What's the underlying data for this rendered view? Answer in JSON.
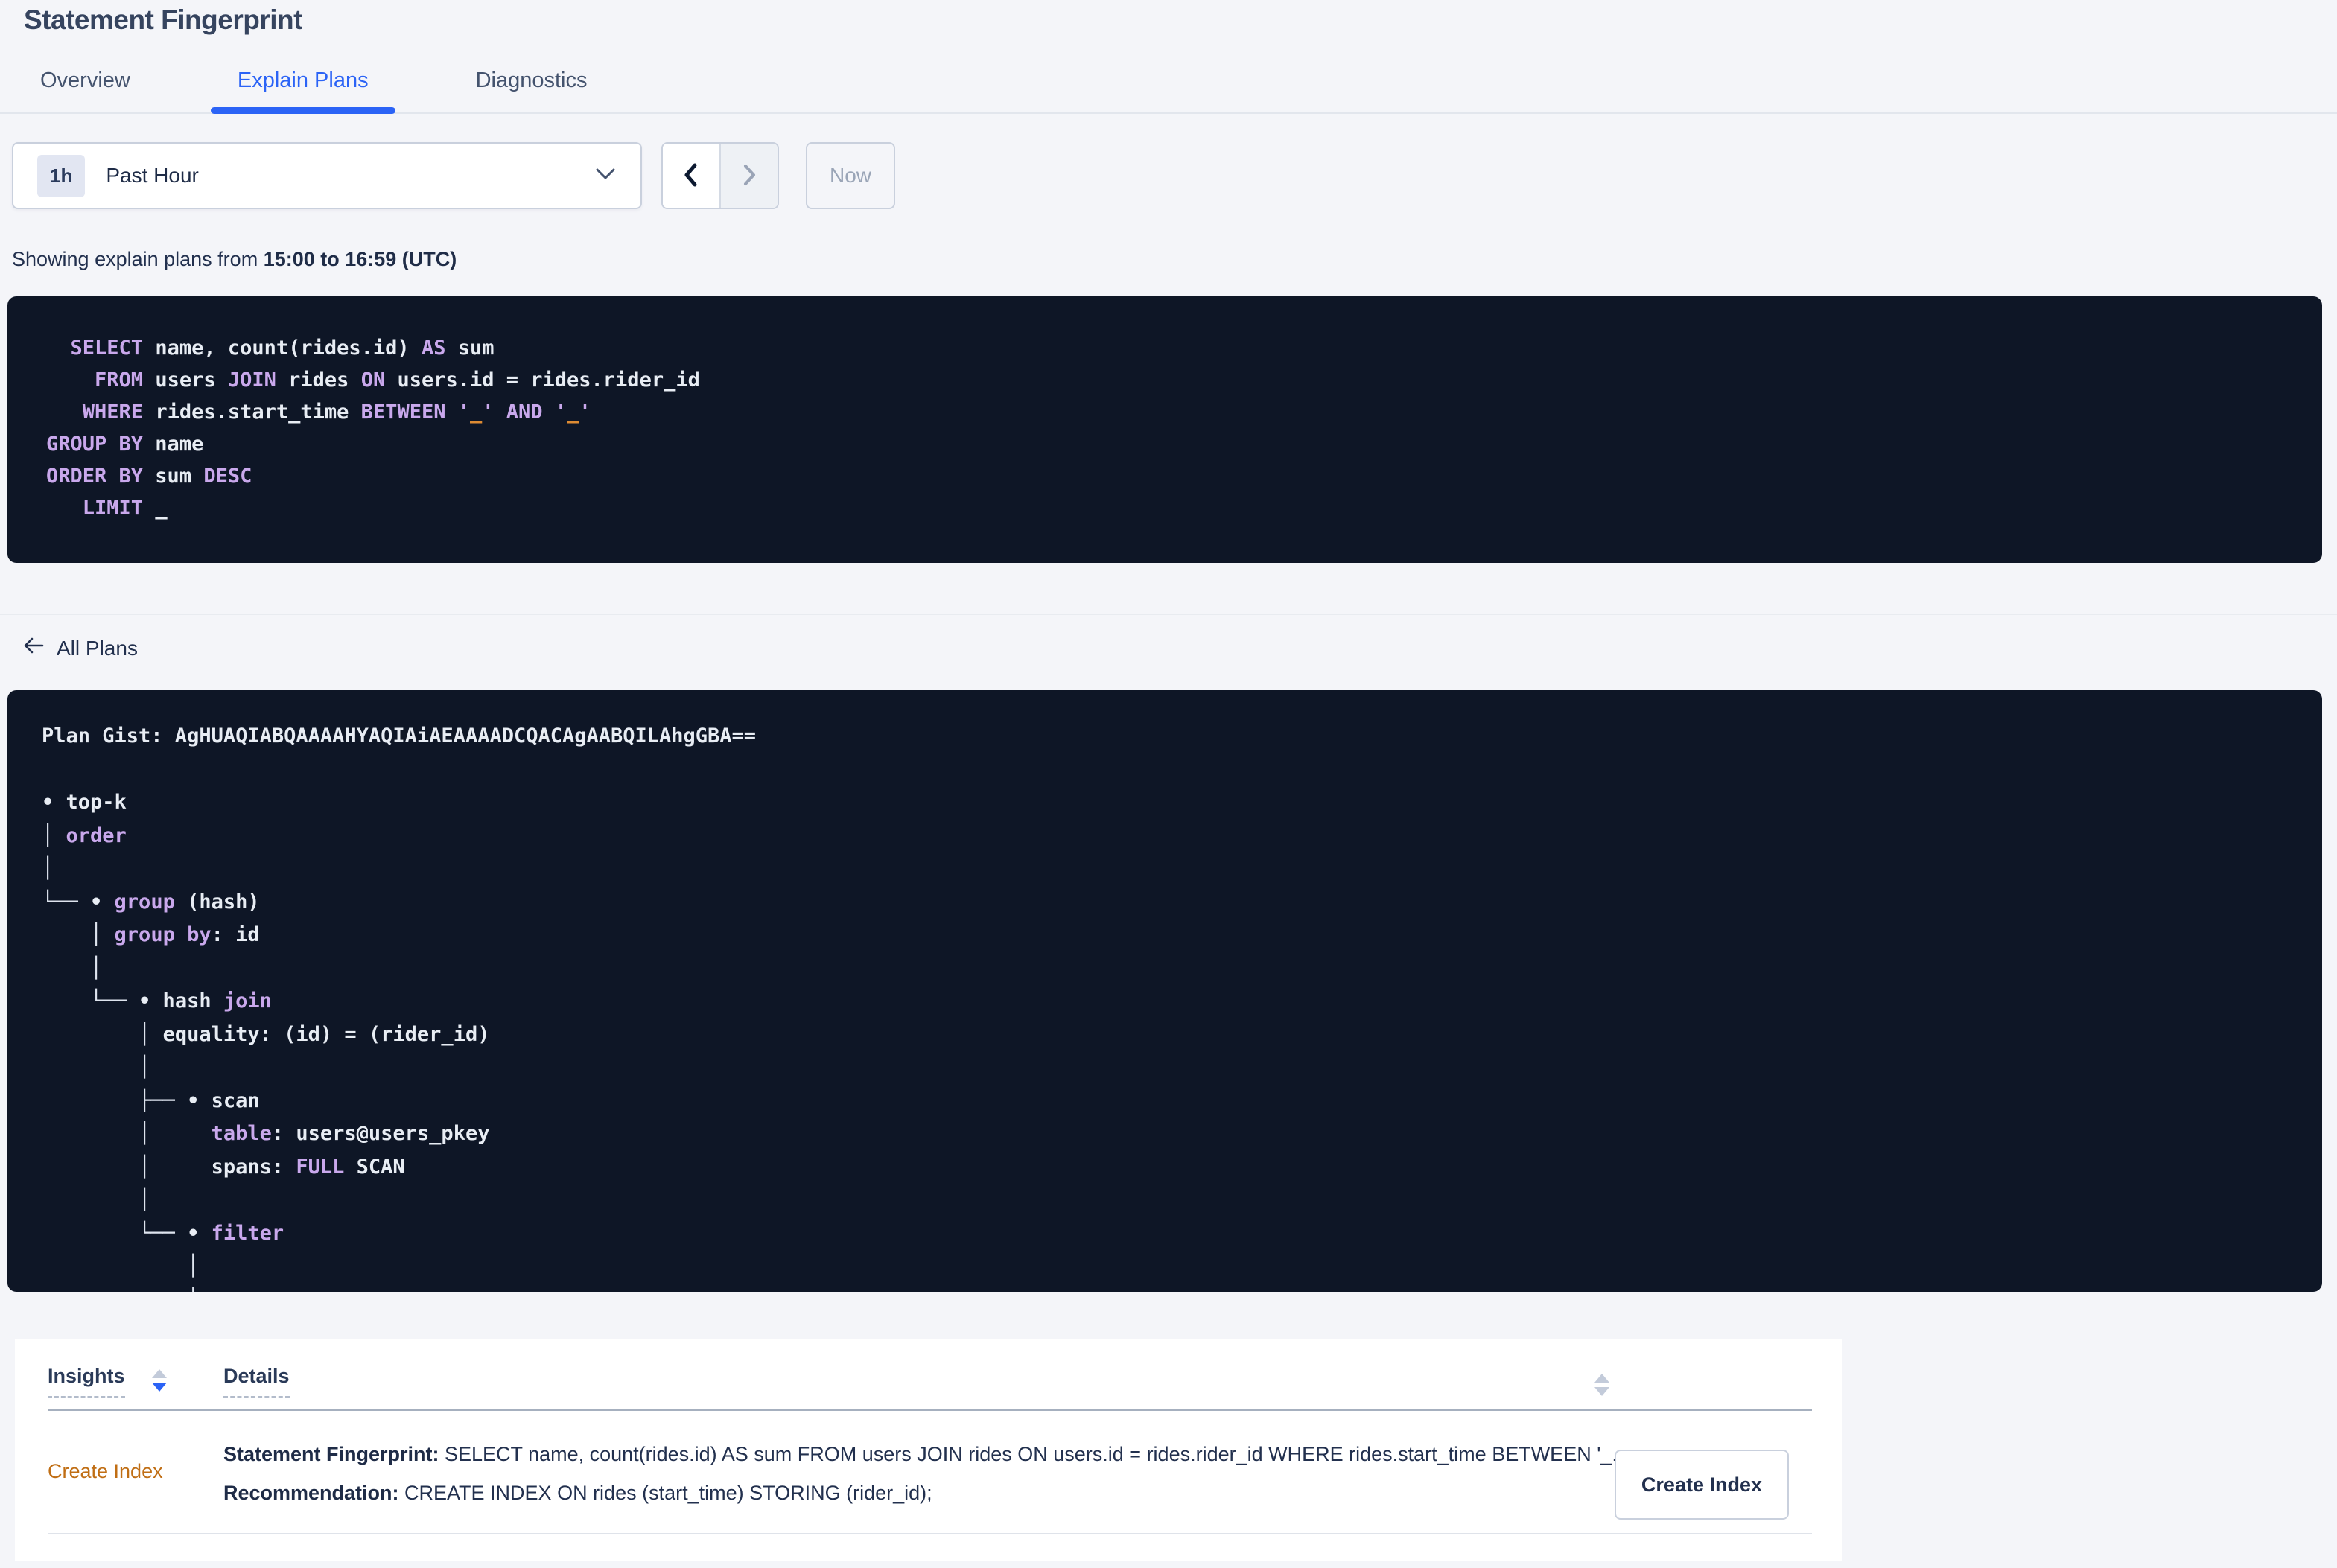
{
  "page": {
    "title": "Statement Fingerprint"
  },
  "tabs": [
    {
      "label": "Overview",
      "active": false
    },
    {
      "label": "Explain Plans",
      "active": true
    },
    {
      "label": "Diagnostics",
      "active": false
    }
  ],
  "time_controls": {
    "interval_badge": "1h",
    "selected_range": "Past Hour",
    "now_button": "Now"
  },
  "status_line": {
    "prefix": "Showing explain plans from ",
    "bold_range": "15:00 to 16:59 (UTC)"
  },
  "sql_statement": {
    "lines": [
      [
        [
          "t",
          "  "
        ],
        [
          "k",
          "SELECT"
        ],
        [
          "t",
          " name, count(rides.id) "
        ],
        [
          "k",
          "AS"
        ],
        [
          "t",
          " sum"
        ]
      ],
      [
        [
          "t",
          "    "
        ],
        [
          "k",
          "FROM"
        ],
        [
          "t",
          " users "
        ],
        [
          "k",
          "JOIN"
        ],
        [
          "t",
          " rides "
        ],
        [
          "k",
          "ON"
        ],
        [
          "t",
          " users.id = rides.rider_id"
        ]
      ],
      [
        [
          "t",
          "   "
        ],
        [
          "k",
          "WHERE"
        ],
        [
          "t",
          " rides.start_time "
        ],
        [
          "k",
          "BETWEEN"
        ],
        [
          "t",
          " "
        ],
        [
          "k",
          "'"
        ],
        [
          "o",
          "_"
        ],
        [
          "k",
          "'"
        ],
        [
          "t",
          " "
        ],
        [
          "k",
          "AND"
        ],
        [
          "t",
          " "
        ],
        [
          "k",
          "'"
        ],
        [
          "o",
          "_"
        ],
        [
          "k",
          "'"
        ]
      ],
      [
        [
          "k",
          "GROUP BY"
        ],
        [
          "t",
          " name"
        ]
      ],
      [
        [
          "k",
          "ORDER BY"
        ],
        [
          "t",
          " sum "
        ],
        [
          "k",
          "DESC"
        ]
      ],
      [
        [
          "t",
          "   "
        ],
        [
          "k",
          "LIMIT"
        ],
        [
          "t",
          " _"
        ]
      ]
    ]
  },
  "explain_plan": {
    "back_link": "All Plans",
    "lines": [
      [
        [
          "t",
          "Plan Gist: AgHUAQIABQAAAAHYAQIAiAEAAAADCQACAgAABQILAhgGBA=="
        ]
      ],
      [],
      [
        [
          "t",
          "• top-k"
        ]
      ],
      [
        [
          "g",
          "│ "
        ],
        [
          "k",
          "order"
        ]
      ],
      [
        [
          "g",
          "│"
        ]
      ],
      [
        [
          "g",
          "└── "
        ],
        [
          "t",
          "• "
        ],
        [
          "k",
          "group"
        ],
        [
          "t",
          " (hash)"
        ]
      ],
      [
        [
          "g",
          "    │ "
        ],
        [
          "k",
          "group by"
        ],
        [
          "t",
          ": id"
        ]
      ],
      [
        [
          "g",
          "    │"
        ]
      ],
      [
        [
          "g",
          "    └── "
        ],
        [
          "t",
          "• hash "
        ],
        [
          "k",
          "join"
        ]
      ],
      [
        [
          "g",
          "        │ "
        ],
        [
          "t",
          "equality: (id) = (rider_id)"
        ]
      ],
      [
        [
          "g",
          "        │"
        ]
      ],
      [
        [
          "g",
          "        ├── "
        ],
        [
          "t",
          "• scan"
        ]
      ],
      [
        [
          "g",
          "        │     "
        ],
        [
          "k",
          "table"
        ],
        [
          "t",
          ": users@users_pkey"
        ]
      ],
      [
        [
          "g",
          "        │     "
        ],
        [
          "t",
          "spans: "
        ],
        [
          "k",
          "FULL"
        ],
        [
          "t",
          " SCAN"
        ]
      ],
      [
        [
          "g",
          "        │"
        ]
      ],
      [
        [
          "g",
          "        └── "
        ],
        [
          "t",
          "• "
        ],
        [
          "k",
          "filter"
        ]
      ],
      [
        [
          "g",
          "            │"
        ]
      ],
      [
        [
          "g",
          "            │"
        ]
      ]
    ]
  },
  "insights_table": {
    "headers": [
      {
        "label": "Insights",
        "sortable": true,
        "sorted": "desc"
      },
      {
        "label": "Details",
        "sortable": true,
        "sorted": "none"
      }
    ],
    "rows": [
      {
        "insight": "Create Index",
        "statement_label": "Statement Fingerprint:",
        "statement": " SELECT name, count(rides.id) AS sum FROM users JOIN rides ON users.id = rides.rider_id WHERE rides.start_time BETWEEN '_...",
        "recommendation_label": "Recommendation:",
        "recommendation": " CREATE INDEX ON rides (start_time) STORING (rider_id);",
        "action_button": "Create Index"
      }
    ]
  },
  "icons": {
    "dropdown": "chevron-down-icon",
    "prev": "chevron-left-icon",
    "next": "chevron-right-icon",
    "back": "arrow-left-icon",
    "sort": "sort-arrows-icon"
  },
  "colors": {
    "accent_blue": "#2b63f6",
    "panel_bg": "#0e1626",
    "code_keyword_purple": "#c9a8ec",
    "code_text": "#e8edf4",
    "code_placeholder_orange": "#dd8b33",
    "insight_link_orange": "#c06e14",
    "page_bg": "#f4f5f9",
    "border": "#c9d0dd"
  }
}
